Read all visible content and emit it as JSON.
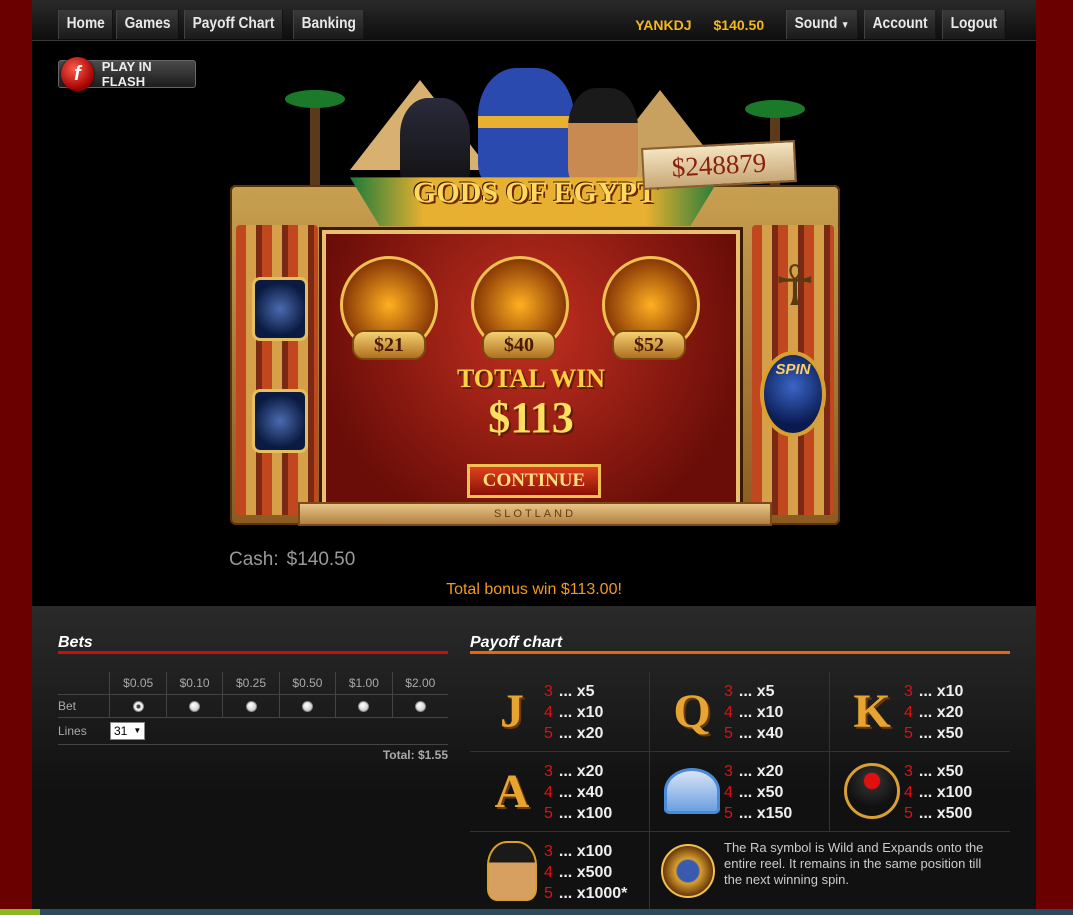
{
  "nav": {
    "left": [
      "Home",
      "Games",
      "Payoff Chart",
      "Banking"
    ],
    "username": "YANKDJ",
    "balance": "$140.50",
    "sound": "Sound",
    "account": "Account",
    "logout": "Logout"
  },
  "flash_button": {
    "label": "PLAY IN FLASH",
    "icon_letter": "f"
  },
  "game": {
    "title": "GODS OF EGYPT",
    "jackpot": "$248879",
    "prizes": [
      "$21",
      "$40",
      "$52"
    ],
    "total_win_label": "TOTAL WIN",
    "total_win_amount": "$113",
    "continue_label": "CONTINUE",
    "spin_label": "SPIN",
    "brand": "SLOTLAND"
  },
  "cash": {
    "label": "Cash:",
    "amount": "$140.50"
  },
  "bonus_message": "Total bonus win $113.00!",
  "bets": {
    "title": "Bets",
    "denominations": [
      "$0.05",
      "$0.10",
      "$0.25",
      "$0.50",
      "$1.00",
      "$2.00"
    ],
    "selected_index": 0,
    "bet_label": "Bet",
    "lines_label": "Lines",
    "lines_value": "31",
    "total": "Total: $1.55"
  },
  "payoff": {
    "title": "Payoff chart",
    "symbols": [
      {
        "symbol": "J",
        "pays": [
          [
            "3",
            "... x5"
          ],
          [
            "4",
            "... x10"
          ],
          [
            "5",
            "... x20"
          ]
        ]
      },
      {
        "symbol": "Q",
        "pays": [
          [
            "3",
            "... x5"
          ],
          [
            "4",
            "... x10"
          ],
          [
            "5",
            "... x40"
          ]
        ]
      },
      {
        "symbol": "K",
        "pays": [
          [
            "3",
            "... x10"
          ],
          [
            "4",
            "... x20"
          ],
          [
            "5",
            "... x50"
          ]
        ]
      },
      {
        "symbol": "A",
        "pays": [
          [
            "3",
            "... x20"
          ],
          [
            "4",
            "... x40"
          ],
          [
            "5",
            "... x100"
          ]
        ]
      },
      {
        "symbol": "eye",
        "pays": [
          [
            "3",
            "... x20"
          ],
          [
            "4",
            "... x50"
          ],
          [
            "5",
            "... x150"
          ]
        ]
      },
      {
        "symbol": "scarab",
        "pays": [
          [
            "3",
            "... x50"
          ],
          [
            "4",
            "... x100"
          ],
          [
            "5",
            "... x500"
          ]
        ]
      },
      {
        "symbol": "cleopatra",
        "pays": [
          [
            "3",
            "... x100"
          ],
          [
            "4",
            "... x500"
          ],
          [
            "5",
            "... x1000*"
          ]
        ]
      }
    ],
    "ra_note": "The Ra symbol is Wild and Expands onto the entire reel. It remains in the same position till the next winning spin."
  }
}
